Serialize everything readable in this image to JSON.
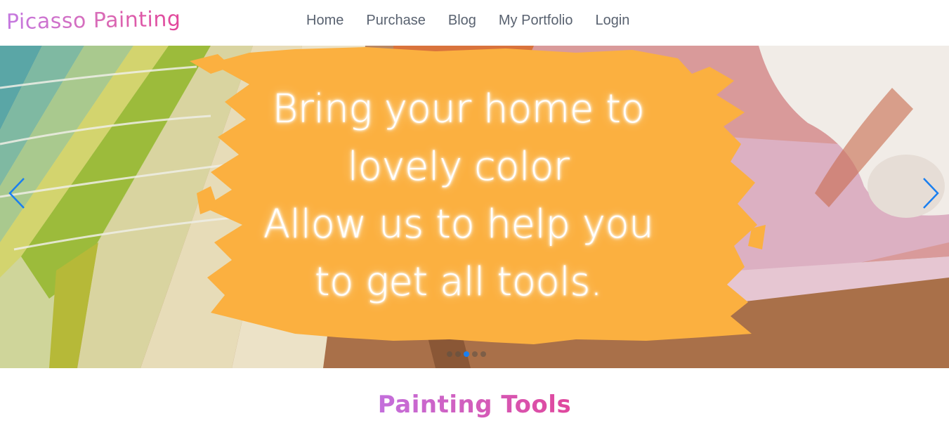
{
  "brand": {
    "name": "Picasso Painting"
  },
  "nav": {
    "links": [
      {
        "label": "Home"
      },
      {
        "label": "Purchase"
      },
      {
        "label": "Blog"
      },
      {
        "label": "My Portfolio"
      },
      {
        "label": "Login"
      }
    ]
  },
  "hero": {
    "lines": [
      "Bring your home to",
      "lovely color",
      "Allow us to help you",
      "to get all tools."
    ],
    "prev_icon": "chevron-left-icon",
    "next_icon": "chevron-right-icon",
    "slides": 5,
    "active_slide": 3
  },
  "section": {
    "title": "Painting Tools"
  },
  "colors": {
    "accent_blue": "#1a7ff0",
    "brush_orange": "#fbb040",
    "brand_pink": "#e2469a",
    "brand_purple": "#c478e0",
    "nav_text": "#596270"
  }
}
